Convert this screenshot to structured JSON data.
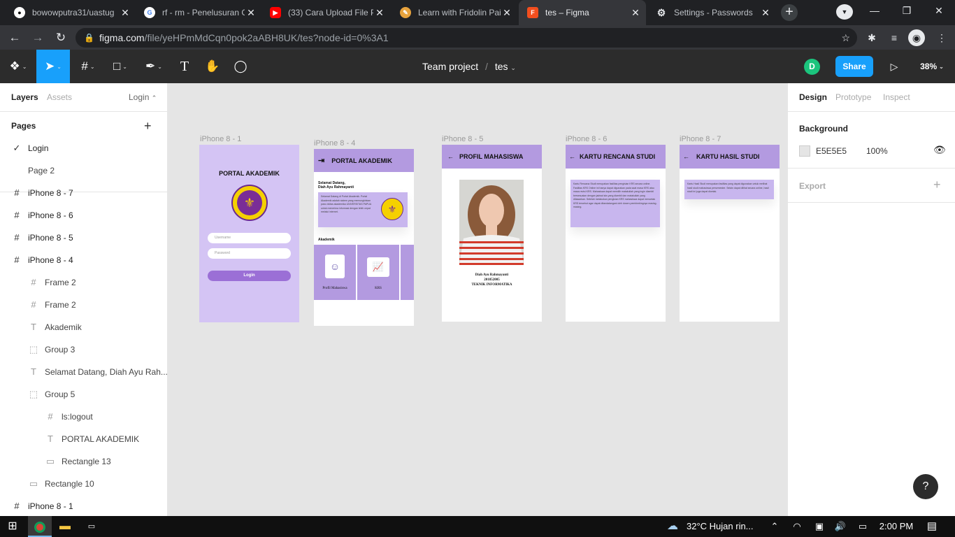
{
  "browser": {
    "tabs": [
      {
        "title": "bowowputra31/uastug",
        "icon": "github-icon"
      },
      {
        "title": "rf - rm - Penelusuran G",
        "icon": "google-icon"
      },
      {
        "title": "(33) Cara Upload File P",
        "icon": "youtube-icon"
      },
      {
        "title": "Learn with Fridolin Pai",
        "icon": "fridolin-icon"
      },
      {
        "title": "tes – Figma",
        "icon": "figma-icon"
      },
      {
        "title": "Settings - Passwords",
        "icon": "settings-icon"
      }
    ],
    "url_host": "figma.com",
    "url_path": "/file/yeHPmMdCqn0pok2aABH8UK/tes?node-id=0%3A1"
  },
  "figma": {
    "project": "Team project",
    "separator": "/",
    "file": "tes",
    "user_initial": "D",
    "share_label": "Share",
    "zoom": "38%"
  },
  "left_panel": {
    "tabs": [
      "Layers",
      "Assets"
    ],
    "page_selector": "Login",
    "pages_title": "Pages",
    "pages": [
      "Login",
      "Page 2"
    ],
    "current_page": "Login",
    "layers": [
      {
        "name": "iPhone 8 - 7",
        "type": "frame",
        "depth": 0
      },
      {
        "name": "iPhone 8 - 6",
        "type": "frame",
        "depth": 0
      },
      {
        "name": "iPhone 8 - 5",
        "type": "frame",
        "depth": 0
      },
      {
        "name": "iPhone 8 - 4",
        "type": "frame",
        "depth": 0
      },
      {
        "name": "Frame 2",
        "type": "frame",
        "depth": 1
      },
      {
        "name": "Frame 2",
        "type": "frame",
        "depth": 1
      },
      {
        "name": "Akademik",
        "type": "text",
        "depth": 1
      },
      {
        "name": "Group 3",
        "type": "group",
        "depth": 1
      },
      {
        "name": "Selamat Datang, Diah Ayu Rah...",
        "type": "text",
        "depth": 1
      },
      {
        "name": "Group 5",
        "type": "group",
        "depth": 1
      },
      {
        "name": "ls:logout",
        "type": "frame",
        "depth": 2
      },
      {
        "name": "PORTAL AKADEMIK",
        "type": "text",
        "depth": 2
      },
      {
        "name": "Rectangle 13",
        "type": "rect",
        "depth": 2
      },
      {
        "name": "Rectangle 10",
        "type": "rect",
        "depth": 1
      },
      {
        "name": "iPhone 8 - 1",
        "type": "frame",
        "depth": 0
      }
    ]
  },
  "right_panel": {
    "tabs": [
      "Design",
      "Prototype",
      "Inspect"
    ],
    "background_title": "Background",
    "bg_hex": "E5E5E5",
    "bg_opacity": "100%",
    "bg_swatch": "#e5e5e5",
    "export_title": "Export"
  },
  "canvas": {
    "frames": [
      {
        "label": "iPhone 8 - 1"
      },
      {
        "label": "iPhone 8 - 4"
      },
      {
        "label": "iPhone 8 - 5"
      },
      {
        "label": "iPhone 8 - 6"
      },
      {
        "label": "iPhone 8 - 7"
      }
    ],
    "f1": {
      "title": "PORTAL AKADEMIK",
      "username_ph": "Username",
      "password_ph": "Password",
      "login": "Login"
    },
    "f4": {
      "title": "PORTAL AKADEMIK",
      "welcome": "Selamat Datang,",
      "name": "Diah Ayu Rahmayanti",
      "body": "Selamat Datang di Portal Akademik. Portal Akademik adalah sistem yang memungkinkan para civitas akademika UNIVERSITAS PAPUA untuk menerima informasi dengan lebih cepat melalui internet.",
      "section": "Akademik",
      "card1": "Profil Mahasiswa",
      "card2": "KRS"
    },
    "f5": {
      "title": "PROFIL MAHASISWA",
      "name": "Diah Ayu Rahmayanti",
      "nim": "201852005",
      "prodi": "TEKNIK INFORMATIKA"
    },
    "f6": {
      "title": "KARTU RENCANA STUDI",
      "body": "Kartu Rencana Studi merupakan fasilitas pengisian KRS secara online. Fasilitas KRS Online ini hanya dapat digunakan pada saat masa KRS atau masa revisi KRS. Mahasiswa dapat memilih matakuliah yang ingin diambil bersesuaian dengan jadwal sks yang diambil dan matakuliah yang ditawarkan. Setelah melakukan pengisian KRS mahasiswa dapat mencetak KRS tersebut agar dapat ditandatangani oleh dosen pembimbingnya masing-masing."
    },
    "f7": {
      "title": "KARTU HASIL STUDI",
      "body": "Kartu Hasil Studi merupakan fasilitas yang dapat digunakan untuk melihat hasil studi mahasiswa persemester. Selain dapat dilihat secara online, hasil studi ini juga dapat dicetak."
    }
  },
  "taskbar": {
    "weather": "32°C  Hujan rin...",
    "time": "2:00 PM"
  },
  "help_label": "?"
}
